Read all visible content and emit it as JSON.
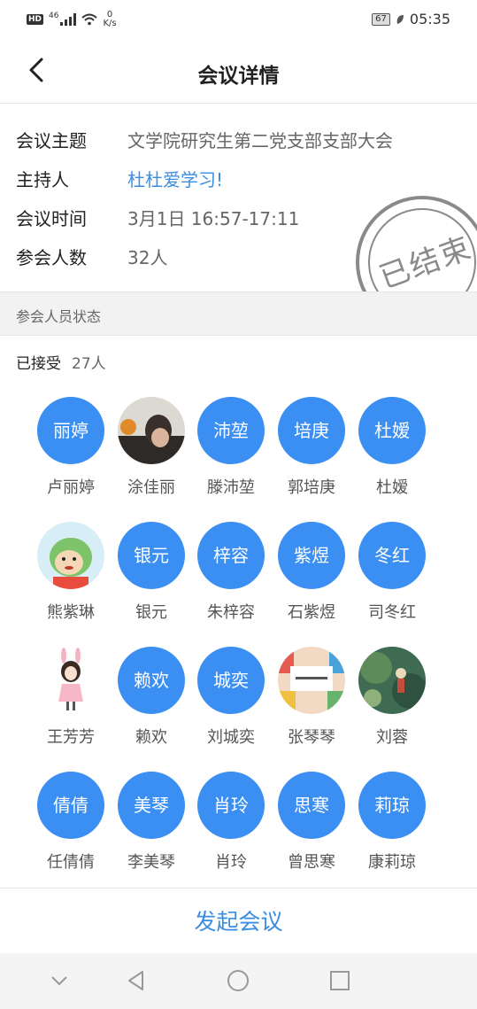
{
  "status_bar": {
    "hd": "HD",
    "network": "46",
    "speed_value": "0",
    "speed_unit": "K/s",
    "battery": "67",
    "time": "05:35"
  },
  "header": {
    "title": "会议详情"
  },
  "info": {
    "topic_label": "会议主题",
    "topic_value": "文学院研究生第二党支部支部大会",
    "host_label": "主持人",
    "host_value": "杜杜爱学习!",
    "time_label": "会议时间",
    "time_value": "3月1日 16:57-17:11",
    "count_label": "参会人数",
    "count_value": "32人",
    "stamp": "已结束"
  },
  "section": {
    "title": "参会人员状态"
  },
  "accepted": {
    "label": "已接受",
    "count": "27人"
  },
  "participants": [
    {
      "avatar": "丽婷",
      "name": "卢丽婷",
      "photo": false
    },
    {
      "avatar": "",
      "name": "涂佳丽",
      "photo": true,
      "kind": "photo1"
    },
    {
      "avatar": "沛堃",
      "name": "滕沛堃",
      "photo": false
    },
    {
      "avatar": "培庚",
      "name": "郭培庚",
      "photo": false
    },
    {
      "avatar": "杜嫒",
      "name": "杜嫒",
      "photo": false
    },
    {
      "avatar": "",
      "name": "熊紫琳",
      "photo": true,
      "kind": "cartoon"
    },
    {
      "avatar": "银元",
      "name": "银元",
      "photo": false
    },
    {
      "avatar": "梓容",
      "name": "朱梓容",
      "photo": false
    },
    {
      "avatar": "紫煜",
      "name": "石紫煜",
      "photo": false
    },
    {
      "avatar": "冬红",
      "name": "司冬红",
      "photo": false
    },
    {
      "avatar": "",
      "name": "王芳芳",
      "photo": true,
      "kind": "girl"
    },
    {
      "avatar": "赖欢",
      "name": "赖欢",
      "photo": false
    },
    {
      "avatar": "城奕",
      "name": "刘城奕",
      "photo": false
    },
    {
      "avatar": "",
      "name": "张琴琴",
      "photo": true,
      "kind": "books"
    },
    {
      "avatar": "",
      "name": "刘蓉",
      "photo": true,
      "kind": "painting"
    },
    {
      "avatar": "倩倩",
      "name": "任倩倩",
      "photo": false
    },
    {
      "avatar": "美琴",
      "name": "李美琴",
      "photo": false
    },
    {
      "avatar": "肖玲",
      "name": "肖玲",
      "photo": false
    },
    {
      "avatar": "思寒",
      "name": "曾思寒",
      "photo": false
    },
    {
      "avatar": "莉琼",
      "name": "康莉琼",
      "photo": false
    }
  ],
  "bottom": {
    "button_label": "发起会议"
  },
  "colors": {
    "accent": "#3b8ff2",
    "link": "#3a8de0",
    "stamp": "#8a8a8a"
  }
}
